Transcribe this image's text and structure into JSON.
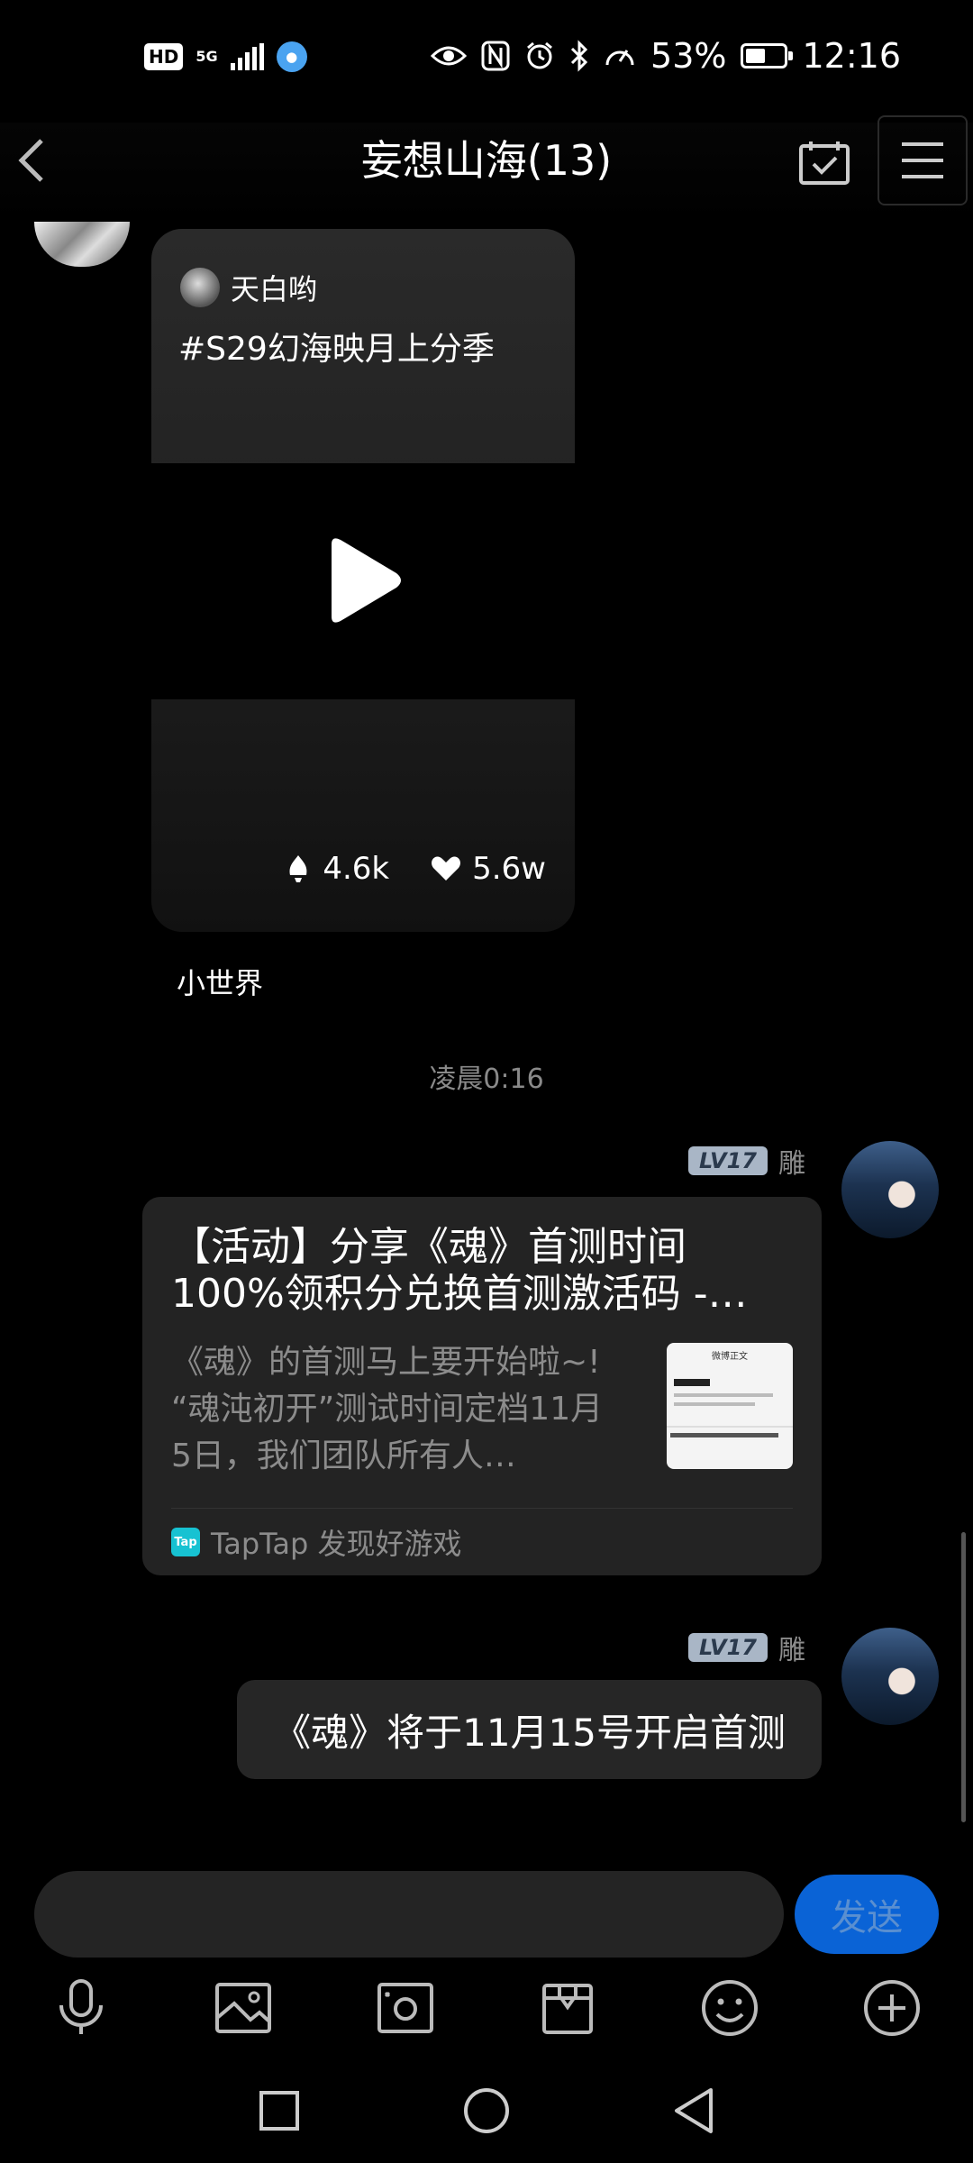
{
  "status_bar": {
    "hd": "HD",
    "network": "5G",
    "time": "12:16",
    "battery_percent": "53%",
    "battery_level": 0.53,
    "icons": [
      "eye-icon",
      "nfc-icon",
      "alarm-icon",
      "bluetooth-icon",
      "speed-icon",
      "battery-icon"
    ]
  },
  "header": {
    "title": "妄想山海(13)",
    "icons": [
      "back-icon",
      "calendar-check-icon",
      "menu-icon"
    ]
  },
  "video_card": {
    "author": "天白哟",
    "tag": "#S29幻海映月上分季",
    "likes_short": "4.6k",
    "hearts": "5.6w",
    "caption": "小世界"
  },
  "time_separator": "凌晨0:16",
  "sender": {
    "level": "LV17",
    "name": "雕"
  },
  "link_card": {
    "title_line1": "【活动】分享《魂》首测时间",
    "title_line2": "100%领积分兑换首测激活码 -…",
    "desc_line1": "《魂》的首测马上要开始啦~!",
    "desc_line2": "“魂沌初开”测试时间定档11月",
    "desc_line3": "5日，我们团队所有人…",
    "thumb_title": "微博正文",
    "source_logo": "Tap",
    "source": "TapTap 发现好游戏"
  },
  "text_message": "《魂》将于11月15号开启首测",
  "composer": {
    "input_value": "",
    "send_label": "发送"
  },
  "toolbar_icons": [
    "mic-icon",
    "image-icon",
    "camera-icon",
    "box-icon",
    "emoji-icon",
    "plus-icon"
  ],
  "nav_icons": [
    "recents-icon",
    "home-icon",
    "back-nav-icon"
  ]
}
